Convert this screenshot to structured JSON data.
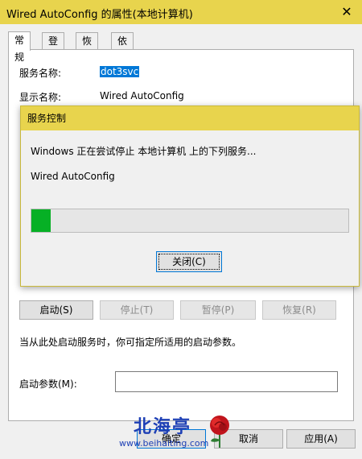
{
  "window": {
    "title": "Wired AutoConfig 的属性(本地计算机)",
    "close_glyph": "✕"
  },
  "tabs": [
    {
      "label": "常规",
      "active": true
    },
    {
      "label": "登录"
    },
    {
      "label": "恢复"
    },
    {
      "label": "依存关系"
    }
  ],
  "general": {
    "service_name_label": "服务名称:",
    "service_name_value": "dot3svc",
    "display_name_label": "显示名称:",
    "display_name_value": "Wired AutoConfig",
    "start_button": "启动(S)",
    "stop_button": "停止(T)",
    "pause_button": "暂停(P)",
    "resume_button": "恢复(R)",
    "hint": "当从此处启动服务时，你可指定所适用的启动参数。",
    "params_label": "启动参数(M):",
    "params_value": ""
  },
  "footer": {
    "ok": "确定",
    "cancel": "取消",
    "apply": "应用(A)"
  },
  "modal": {
    "title": "服务控制",
    "message": "Windows 正在尝试停止 本地计算机 上的下列服务...",
    "service": "Wired AutoConfig",
    "progress": 0.06,
    "close_button": "关闭(C)"
  },
  "watermark": {
    "text": "北海亭",
    "url": "www.beihaiting.com"
  },
  "colors": {
    "titlebar": "#e8d44d",
    "progress_fill": "#06b025",
    "selection": "#0078d7"
  }
}
